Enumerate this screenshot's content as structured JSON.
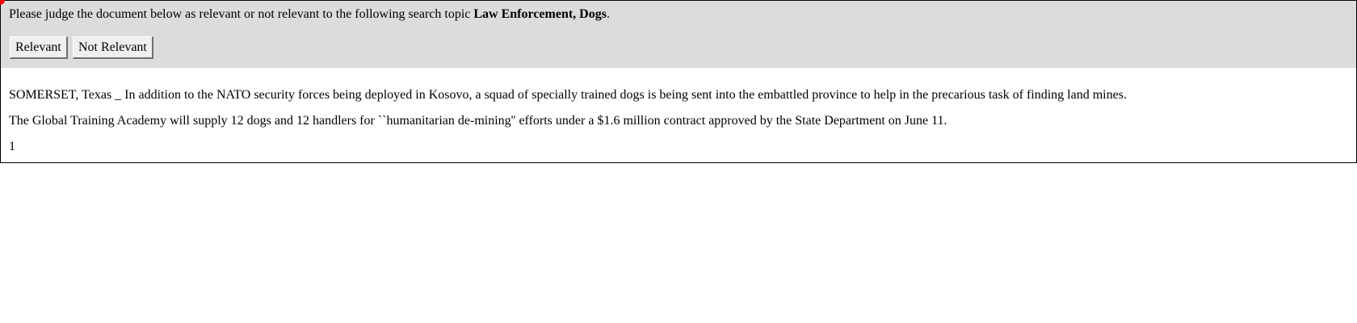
{
  "instruction": {
    "prefix": "Please judge the document below as relevant or not relevant to the following search topic ",
    "topic": "Law Enforcement, Dogs",
    "suffix": "."
  },
  "buttons": {
    "relevant_label": "Relevant",
    "not_relevant_label": "Not Relevant"
  },
  "document": {
    "paragraphs": [
      "SOMERSET, Texas _ In addition to the NATO security forces being deployed in Kosovo, a squad of specially trained dogs is being sent into the embattled province to help in the precarious task of finding land mines.",
      "The Global Training Academy will supply 12 dogs and 12 handlers for ``humanitarian de-mining'' efforts under a $1.6 million contract approved by the State Department on June 11.",
      "1"
    ]
  },
  "colors": {
    "header_background": "#dcdcdc",
    "cursor_indicator": "#ff0000"
  }
}
